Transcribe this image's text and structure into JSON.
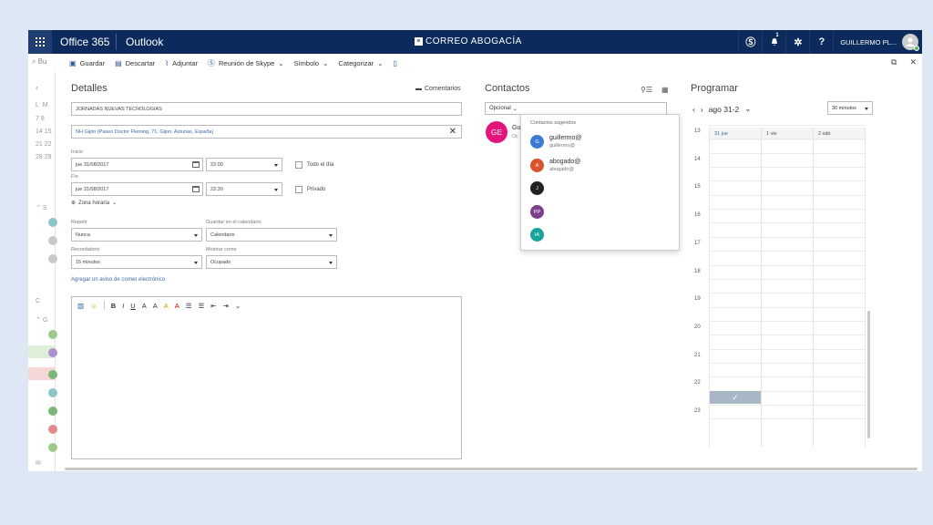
{
  "topbar": {
    "brand": "Office 365",
    "app": "Outlook",
    "logo_text": "CORREO ABOGACÍA",
    "notification_count": "1",
    "user_name": "GUILLERMO PL..."
  },
  "toolbar": {
    "search": "Bu",
    "items": [
      "Guardar",
      "Descartar",
      "Adjuntar",
      "Reunión de Skype",
      "Símbolo",
      "Categorizar"
    ]
  },
  "details": {
    "title": "Detalles",
    "comments": "Comentarios",
    "subject": "JORNADAS NUEVAS TECNOLOGIAS",
    "location": "NH Gijón (Paseo Doctor Fleming, 71, Gijon, Asturias, España)",
    "start_label": "Inicio",
    "start_date": "jue 31/08/2017",
    "start_time": "22:00",
    "allday_label": "Todo el día",
    "end_label": "Fin",
    "end_date": "jue 31/08/2017",
    "end_time": "22:30",
    "private_label": "Privado",
    "timezone": "Zona horaria",
    "repeat_label": "Repetir",
    "repeat_value": "Nunca",
    "save_cal_label": "Guardar en el calendario",
    "save_cal_value": "Calendario",
    "reminder_label": "Recordatorio",
    "reminder_value": "15 minutos",
    "show_as_label": "Mostrar como",
    "show_as_value": "Ocupado",
    "email_reminder": "Agregar un aviso de correo electrónico"
  },
  "contacts": {
    "title": "Contactos",
    "optional": "Opcional",
    "attendee_initials": "GE",
    "attendee_name": "Gu",
    "attendee_sub": "Oc",
    "suggest_title": "Contactos sugeridos",
    "suggestions": [
      {
        "initials": "G",
        "name": "guillermo@",
        "email": "guillermo@",
        "color": "#3a7bd5"
      },
      {
        "initials": "A",
        "name": "abogado@",
        "email": "abogado@",
        "color": "#d9532c"
      },
      {
        "initials": "J",
        "name": "",
        "email": "",
        "color": "#222222"
      },
      {
        "initials": "PP",
        "name": "",
        "email": "",
        "color": "#7b3f8c"
      },
      {
        "initials": "IA",
        "name": "",
        "email": "",
        "color": "#18a39a"
      }
    ]
  },
  "schedule": {
    "title": "Programar",
    "range": "ago 31-2",
    "interval": "30 minutos",
    "days": [
      "31 jue",
      "1 vie",
      "2 sáb"
    ],
    "hours": [
      "13",
      "14",
      "15",
      "16",
      "17",
      "18",
      "19",
      "20",
      "21",
      "22",
      "23"
    ]
  },
  "leftstrip": {
    "weekday_letters": [
      "L",
      "M"
    ],
    "week_rows": [
      "7 8",
      "14 15",
      "21 22",
      "28 29"
    ],
    "s_label": "S",
    "g_label": "G",
    "c_label": "C"
  }
}
